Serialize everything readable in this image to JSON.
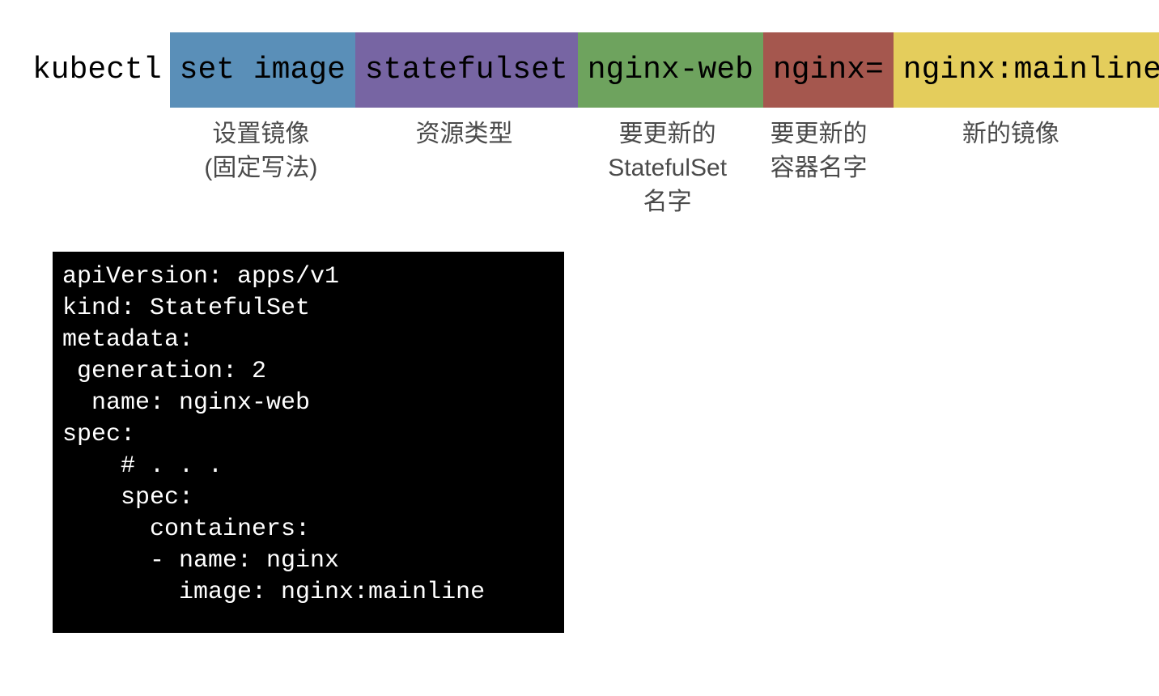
{
  "command": {
    "prefix": "kubectl",
    "segments": [
      {
        "text": "set image",
        "label": "设置镜像\n(固定写法)"
      },
      {
        "text": "statefulset",
        "label": "资源类型"
      },
      {
        "text": "nginx-web",
        "label": "要更新的\nStatefulSet\n名字"
      },
      {
        "text": "nginx=",
        "label": "要更新的\n容器名字"
      },
      {
        "text": "nginx:mainline",
        "label": "新的镜像"
      }
    ]
  },
  "yaml": {
    "lines": [
      "apiVersion: apps/v1",
      "kind: StatefulSet",
      "metadata:",
      " generation: 2",
      "  name: nginx-web",
      "spec:",
      "    # . . .",
      "    spec:",
      "      containers:",
      "      - name: nginx",
      "        image: nginx:mainline"
    ]
  }
}
